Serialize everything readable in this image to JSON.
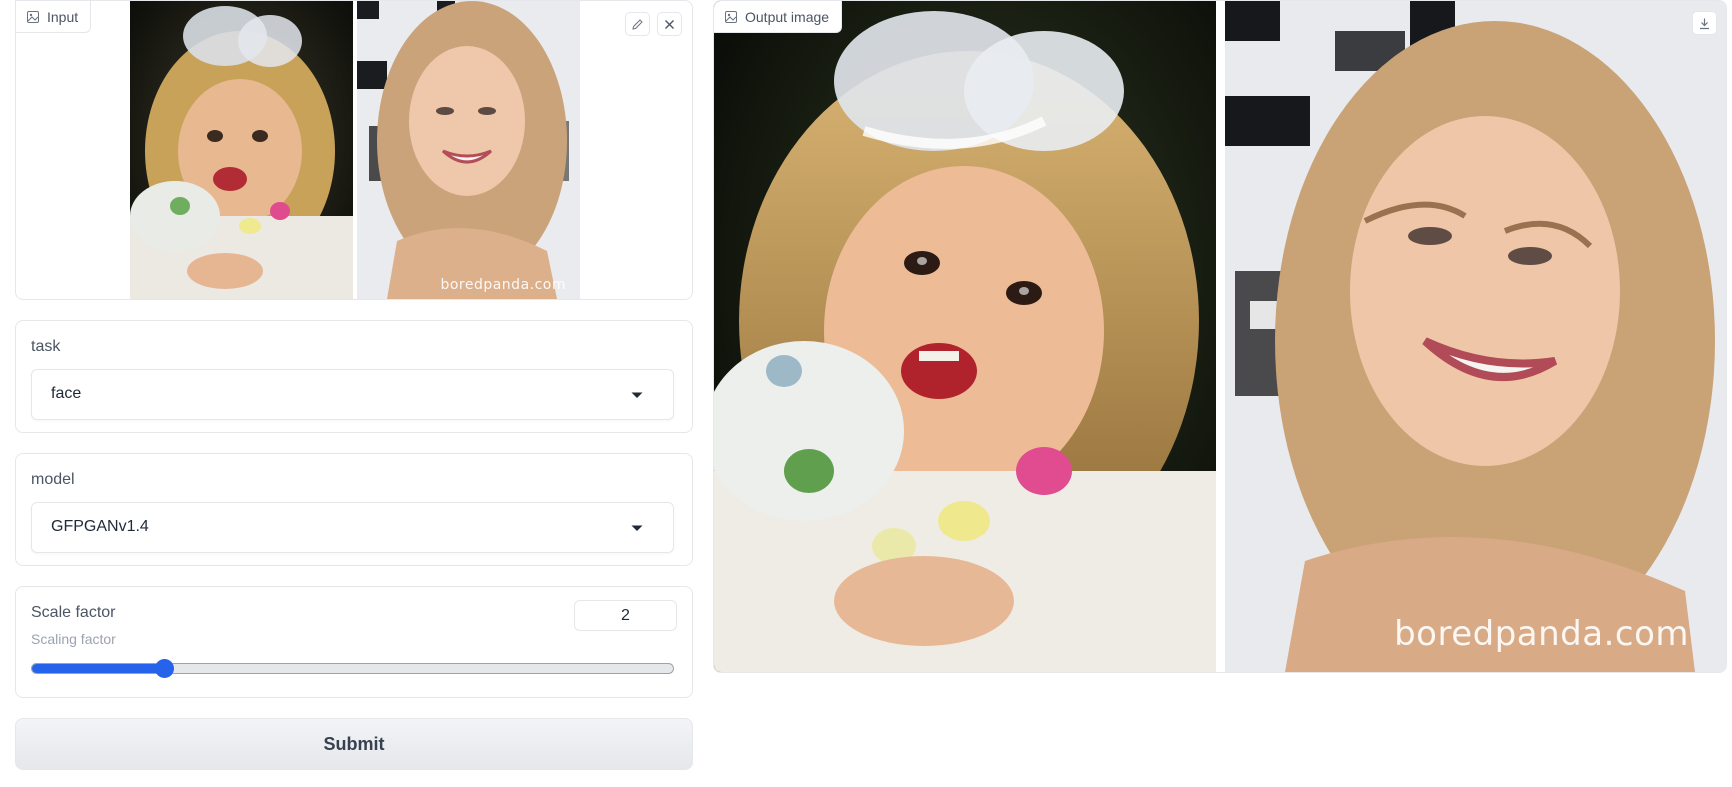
{
  "input": {
    "label": "Input",
    "label_icon": "image-icon",
    "buttons": [
      "edit-icon",
      "close-icon"
    ],
    "watermark": "boredpanda.com"
  },
  "task": {
    "label": "task",
    "value": "face"
  },
  "model": {
    "label": "model",
    "value": "GFPGANv1.4"
  },
  "scale": {
    "label": "Scale factor",
    "info": "Scaling factor",
    "value": "2",
    "level_percent": 20.7
  },
  "submit": {
    "label": "Submit"
  },
  "output": {
    "label": "Output image",
    "label_icon": "image-icon",
    "download_icon": "download-icon",
    "watermark": "boredpanda.com"
  },
  "colors": {
    "accent": "#2563eb",
    "border": "#e5e7eb"
  }
}
